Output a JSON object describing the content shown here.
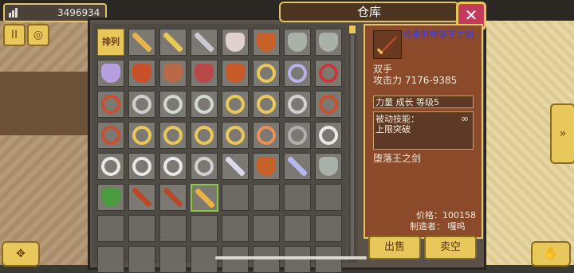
{
  "header": {
    "gold_value": "3496934",
    "title": "仓库",
    "close_label": "✕"
  },
  "left_buttons": {
    "pause_label": "II",
    "coins_label": "◎"
  },
  "sort_button_label": "排列",
  "inventory": [
    {
      "icon": "sword-icon",
      "color": "#e8b44a"
    },
    {
      "icon": "sword-icon",
      "color": "#e8c85a"
    },
    {
      "icon": "sword-icon",
      "color": "#c9c9d0"
    },
    {
      "icon": "shield-icon",
      "color": "#e0d0d0"
    },
    {
      "icon": "shield-icon",
      "color": "#c8602a"
    },
    {
      "icon": "shield-icon",
      "color": "#a8b0a8"
    },
    {
      "icon": "shield-icon",
      "color": "#a8b0a8"
    },
    {
      "icon": "helmet-icon",
      "color": "#b8a0e0"
    },
    {
      "icon": "helmet-icon",
      "color": "#c85028"
    },
    {
      "icon": "helmet-icon",
      "color": "#b86a48"
    },
    {
      "icon": "armor-icon",
      "color": "#b84848"
    },
    {
      "icon": "armor-icon",
      "color": "#c85a2a"
    },
    {
      "icon": "ring-icon",
      "color": "#e8c85a"
    },
    {
      "icon": "ring-icon",
      "color": "#b8b0e8"
    },
    {
      "icon": "ring-icon",
      "color": "#c83838"
    },
    {
      "icon": "ring-icon",
      "color": "#c85030"
    },
    {
      "icon": "ring-icon",
      "color": "#d0d0d0"
    },
    {
      "icon": "ring-icon",
      "color": "#d0d8d0"
    },
    {
      "icon": "ring-icon",
      "color": "#d0d8d0"
    },
    {
      "icon": "necklace-icon",
      "color": "#e8c85a"
    },
    {
      "icon": "ring-icon",
      "color": "#e8c85a"
    },
    {
      "icon": "ring-icon",
      "color": "#d0d0d0"
    },
    {
      "icon": "necklace-icon",
      "color": "#c85030"
    },
    {
      "icon": "bracelet-icon",
      "color": "#c85030"
    },
    {
      "icon": "ring-icon",
      "color": "#e8c85a"
    },
    {
      "icon": "ring-icon",
      "color": "#e8c85a"
    },
    {
      "icon": "ring-icon",
      "color": "#e8c85a"
    },
    {
      "icon": "ring-icon",
      "color": "#e8c85a"
    },
    {
      "icon": "bracelet-icon",
      "color": "#e8905a"
    },
    {
      "icon": "bracelet-icon",
      "color": "#b0b0b0"
    },
    {
      "icon": "bracelet-icon",
      "color": "#e8e8e8"
    },
    {
      "icon": "bracelet-icon",
      "color": "#e8e8e8"
    },
    {
      "icon": "bracelet-icon",
      "color": "#e8e8e8"
    },
    {
      "icon": "bracelet-icon",
      "color": "#e8e8e8"
    },
    {
      "icon": "necklace-icon",
      "color": "#d0d0d0"
    },
    {
      "icon": "axe-icon",
      "color": "#d8d8e8"
    },
    {
      "icon": "shield-icon",
      "color": "#c8602a"
    },
    {
      "icon": "sword-icon",
      "color": "#b8b8f0"
    },
    {
      "icon": "shield-icon",
      "color": "#a8b0a8"
    },
    {
      "icon": "armor-icon",
      "color": "#4a9a40"
    },
    {
      "icon": "sword-icon",
      "color": "#b84a2a"
    },
    {
      "icon": "sword-icon",
      "color": "#b84a2a"
    },
    {
      "icon": "sword-icon",
      "color": "#e8b44a"
    }
  ],
  "detail": {
    "name": "传奇的堕落王之剑",
    "type": "双手",
    "attack": "攻击力  7176-9385",
    "stats": "力量  成长  等级5",
    "skill_label": "被动技能：",
    "skill_name": "上限突破",
    "desc": "堕落王之剑",
    "price": "价格：100158",
    "maker": "制造者：  嘎呜"
  },
  "buttons": {
    "sell": "出售",
    "sell_all": "卖空"
  },
  "side_arrow_label": "»",
  "bottom_left_label": "✥",
  "bottom_right_label": "✋"
}
